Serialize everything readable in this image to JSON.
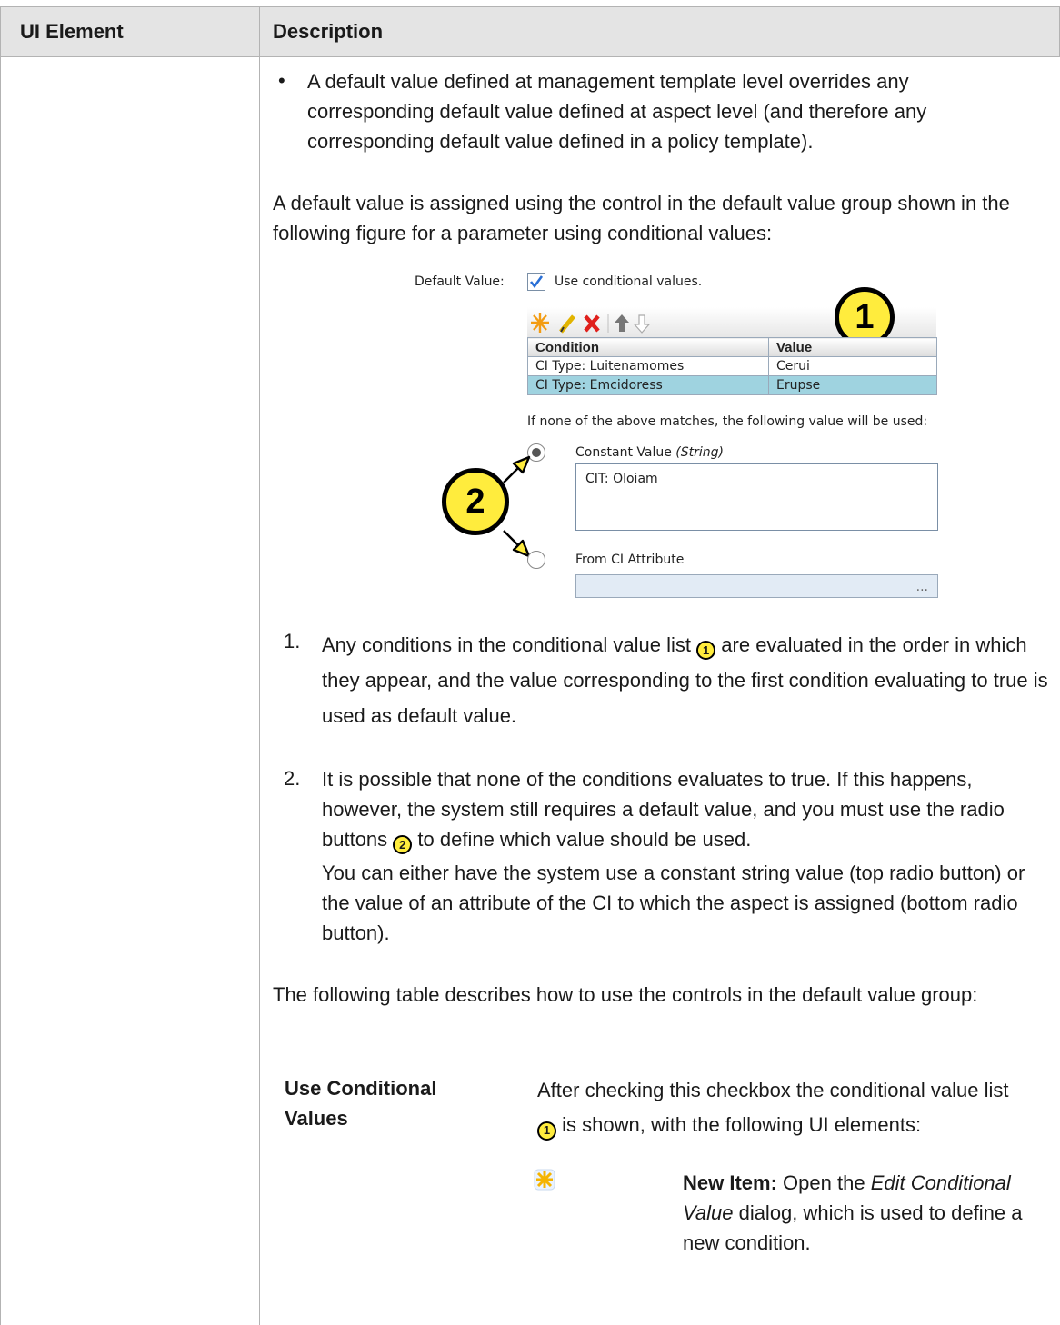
{
  "header": {
    "col1": "UI Element",
    "col2": "Description"
  },
  "bullet_intro": "A default value defined at management template level overrides any corresponding default value defined at aspect level (and therefore any corresponding default value defined in a policy template).",
  "para_assign": "A default value is assigned using the control in the default value group shown in the following figure for a parameter using conditional values:",
  "figure": {
    "default_value_label": "Default Value:",
    "use_conditional_label": "Use conditional values.",
    "use_conditional_checked": true,
    "callout1": "1",
    "callout2": "2",
    "toolbar_icons": [
      "new-item-icon",
      "edit-icon",
      "delete-icon",
      "move-up-icon",
      "move-down-icon"
    ],
    "columns": [
      "Condition",
      "Value"
    ],
    "rows": [
      {
        "condition": "CI Type: Luitenamomes",
        "value": "Cerui"
      },
      {
        "condition": "CI Type: Emcidoress",
        "value": "Erupse"
      }
    ],
    "fallback_text": "If none of the above matches, the following value will be used:",
    "constant_label": "Constant Value",
    "constant_type": "(String)",
    "constant_value": "CIT: Oloiam",
    "from_ci_label": "From CI Attribute",
    "attr_button": "...",
    "accent": "#ffec3d"
  },
  "list": [
    {
      "num": "1.",
      "before": "Any conditions in the conditional value list",
      "badge": "1",
      "after": "are evaluated in the order in which they appear, and the value corresponding to the first condition evaluating to true is used as default value."
    },
    {
      "num": "2.",
      "before": "It is possible that none of the conditions evaluates to true. If this happens, however, the system still requires a default value, and you must use the radio buttons",
      "badge": "2",
      "after": "to define which value should be used.",
      "extra": "You can either have the system use a constant string value (top radio button) or the value of an attribute of the CI to which the aspect is assigned (bottom radio button)."
    }
  ],
  "para_table": "The following table describes how to use the controls in the default value group:",
  "inner": {
    "label": "Use Conditional Values",
    "desc_before": "After checking this checkbox the conditional value list",
    "desc_badge": "1",
    "desc_after": "is shown, with the following UI elements:",
    "new_item_bold": "New Item:",
    "new_item_t1": "Open the",
    "new_item_italic": "Edit Conditional Value",
    "new_item_t2": "dialog, which is used to define a new condition."
  }
}
